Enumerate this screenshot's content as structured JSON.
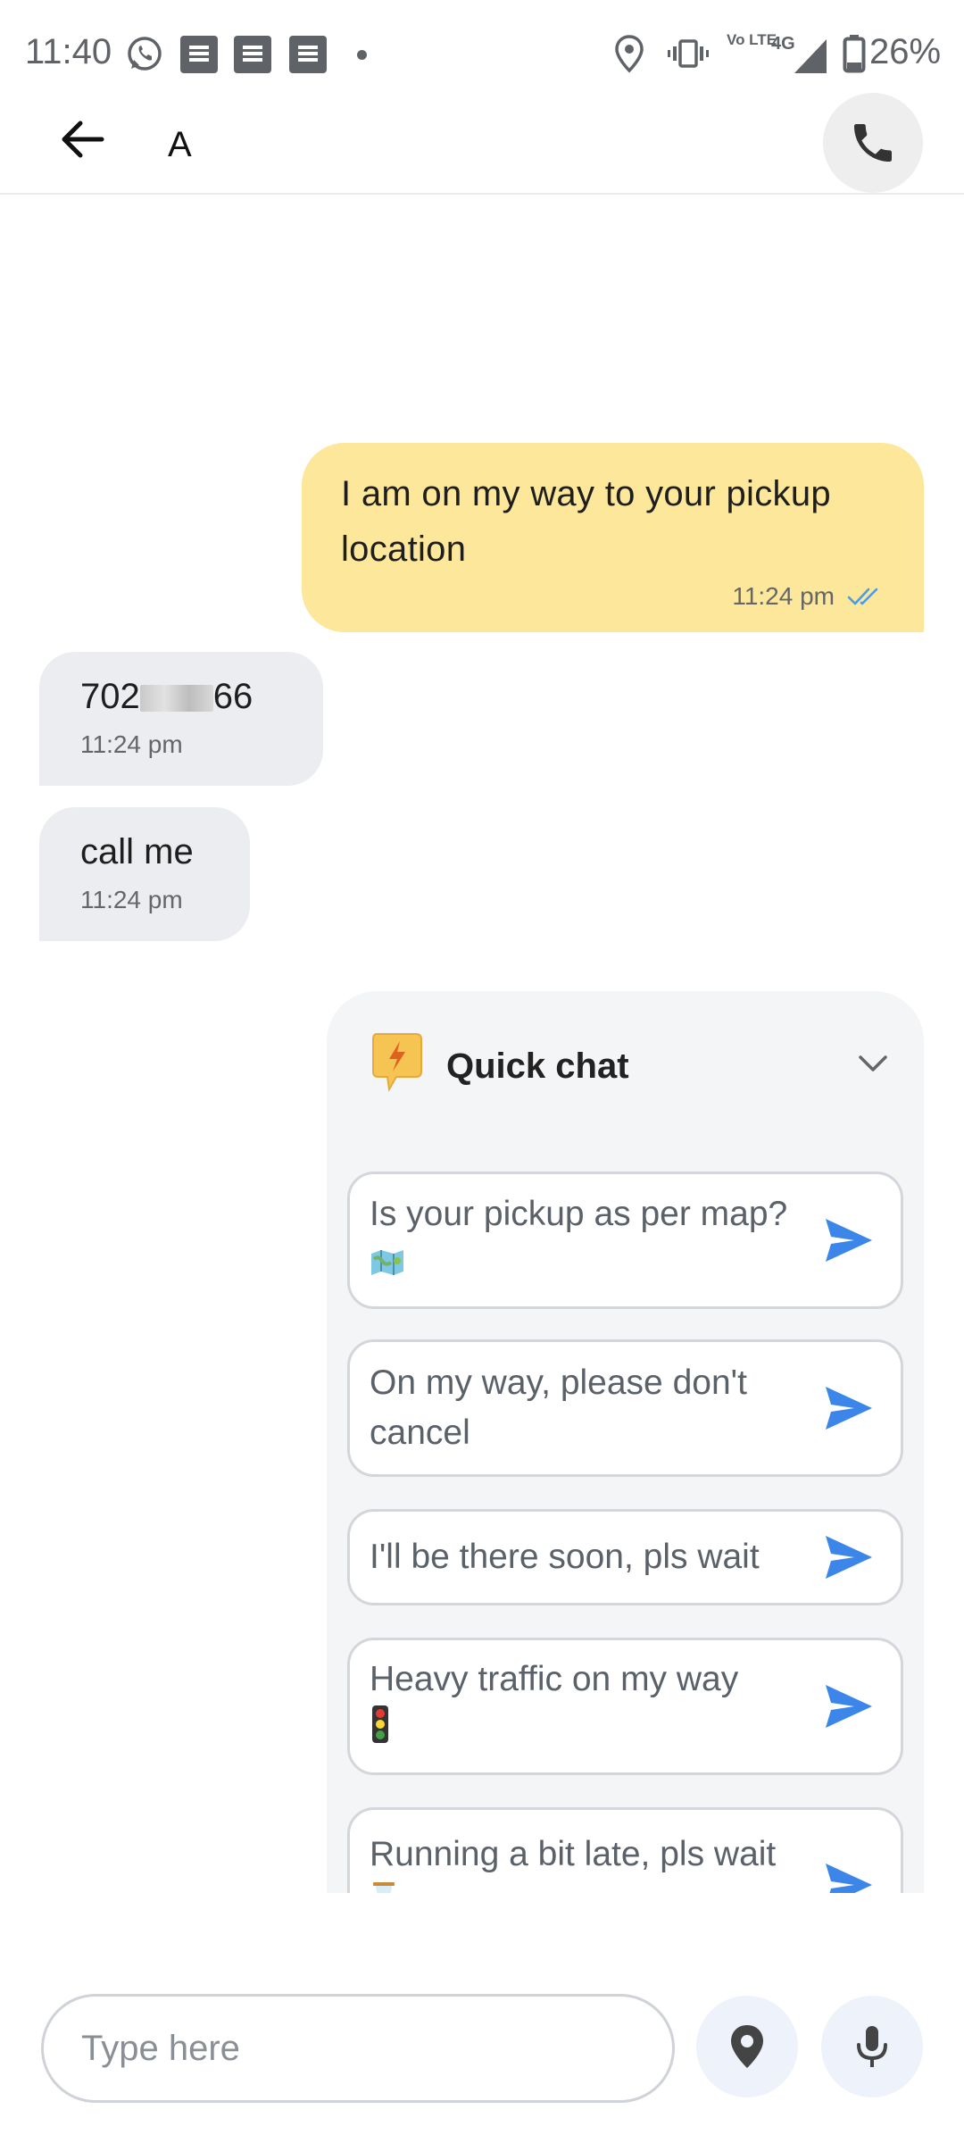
{
  "status_bar": {
    "time": "11:40",
    "battery": "26%",
    "network": "4G",
    "volte": "Vo LTE"
  },
  "header": {
    "title": "A"
  },
  "messages": [
    {
      "direction": "outgoing",
      "text": "I am on my way to your pickup location",
      "time": "11:24 pm",
      "status": "read"
    },
    {
      "direction": "incoming",
      "text_prefix": "702",
      "text_suffix": "66",
      "time": "11:24 pm"
    },
    {
      "direction": "incoming",
      "text": "call me",
      "time": "11:24 pm"
    }
  ],
  "quick_chat": {
    "title": "Quick chat",
    "options": [
      {
        "text": "Is your pickup as per map?",
        "emoji": "map-icon"
      },
      {
        "text": "On my way, please don't cancel"
      },
      {
        "text": "I'll be there soon, pls wait"
      },
      {
        "text": "Heavy traffic on my way",
        "emoji": "traffic-light-icon"
      },
      {
        "text": "Running a bit late, pls wait",
        "emoji": "hourglass-icon"
      }
    ]
  },
  "input": {
    "placeholder": "Type here"
  },
  "colors": {
    "outgoing_bubble": "#fce79a",
    "incoming_bubble": "#ebedf0",
    "send_accent": "#3b86e8",
    "read_tick": "#4a9be8"
  }
}
